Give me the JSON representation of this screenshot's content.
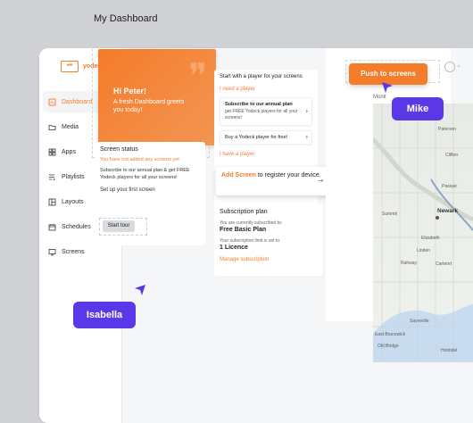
{
  "app": {
    "logo_text": "yodeck",
    "logo_glyph": "❝❞",
    "title": "My Dashboard",
    "accent": "#f47c2a",
    "purple": "#5a38e8"
  },
  "sidebar": {
    "items": [
      {
        "label": "Dashboard",
        "icon": "dashboard-icon"
      },
      {
        "label": "Media",
        "icon": "folder-icon"
      },
      {
        "label": "Apps",
        "icon": "apps-icon"
      },
      {
        "label": "Playlists",
        "icon": "playlist-icon"
      },
      {
        "label": "Layouts",
        "icon": "layout-icon"
      },
      {
        "label": "Schedules",
        "icon": "calendar-icon"
      },
      {
        "label": "Screens",
        "icon": "monitor-icon"
      }
    ]
  },
  "hero": {
    "title": "Hi Peter!",
    "subtitle": "A fresh Dashboard greets you today!"
  },
  "screen_status": {
    "title": "Screen status",
    "warning": "You have not added any screens yet",
    "body": "Subscribe to our annual plan & get FREE Yodeck players for all your screens!",
    "setup": "Set up your first screen",
    "tour_button": "Start tour"
  },
  "players": {
    "title": "Start with a player for your screens",
    "need_label": "I need a player",
    "option1_title": "Subscribe to our annual plan",
    "option1_body": "get FREE Yodeck players for all your screens!",
    "option2": "Buy a Yodeck player for free!",
    "have_label": "I have a player"
  },
  "add_screen": {
    "lead": "Add Screen",
    "text": "to register your device."
  },
  "subscription": {
    "title": "Subscription plan",
    "current_label": "You are currently subscribed to:",
    "plan": "Free Basic Plan",
    "limit_label": "Your subscription limit is set to:",
    "limit": "1 Licence",
    "manage": "Manage subscription"
  },
  "map": {
    "label": "Monit",
    "places": [
      "Paterson",
      "Clifton",
      "Passaic",
      "Summit",
      "Newark",
      "Elizabeth",
      "Linden",
      "Rahway",
      "Carteret",
      "Sayreville",
      "East Brunswick",
      "Old Bridge",
      "Holmdel"
    ]
  },
  "collaboration": {
    "push_button": "Push to screens",
    "mike": "Mike",
    "isabella": "Isabella"
  }
}
